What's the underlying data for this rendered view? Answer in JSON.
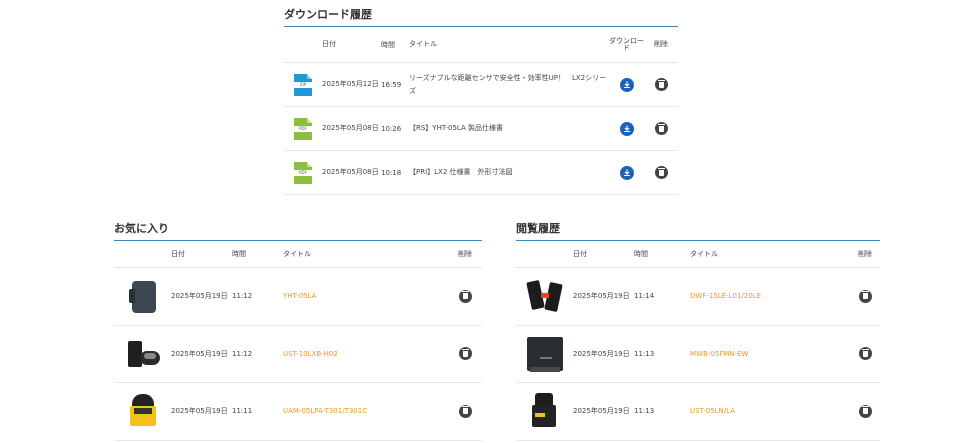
{
  "downloads": {
    "title": "ダウンロード履歴",
    "headers": {
      "date": "日付",
      "time": "時間",
      "title": "タイトル",
      "download": "ダウンロード",
      "delete": "削除"
    },
    "rows": [
      {
        "icon": "zip-file-icon",
        "icon_text": "ZIP",
        "date": "2025年05月12日",
        "time": "16:59",
        "title": "リーズナブルな距離センサで安全性・効率性UP！　LX2シリーズ"
      },
      {
        "icon": "pdf-file-icon",
        "icon_text": "PDF",
        "date": "2025年05月08日",
        "time": "10:26",
        "title": "【RS】YHT-05LA 製品仕様書"
      },
      {
        "icon": "pdf-file-icon",
        "icon_text": "PDF",
        "date": "2025年05月08日",
        "time": "10:18",
        "title": "【PRI】LX2 仕様書　外形寸法図"
      }
    ]
  },
  "favorites": {
    "title": "お気に入り",
    "headers": {
      "date": "日付",
      "time": "時間",
      "title": "タイトル",
      "delete": "削除"
    },
    "rows": [
      {
        "date": "2025年05月19日",
        "time": "11:12",
        "title": "YHT-05LA"
      },
      {
        "date": "2025年05月19日",
        "time": "11:12",
        "title": "UST-10LXB-H02"
      },
      {
        "date": "2025年05月19日",
        "time": "11:11",
        "title": "UAM-05LPA-T301/T301C"
      }
    ]
  },
  "viewed": {
    "title": "閲覧履歴",
    "headers": {
      "date": "日付",
      "time": "時間",
      "title": "タイトル",
      "delete": "削除"
    },
    "rows": [
      {
        "date": "2025年05月19日",
        "time": "11:14",
        "title": "DWF-15LE-L01/20LE"
      },
      {
        "date": "2025年05月19日",
        "time": "11:13",
        "title": "MWB-05FMN-EW"
      },
      {
        "date": "2025年05月19日",
        "time": "11:13",
        "title": "UST-05LN/LA"
      }
    ]
  },
  "colors": {
    "accent": "#3a87b8",
    "link": "#e99a20",
    "download": "#1d63b5",
    "zip": "#1f9ad6",
    "pdf": "#8cbf3f"
  }
}
